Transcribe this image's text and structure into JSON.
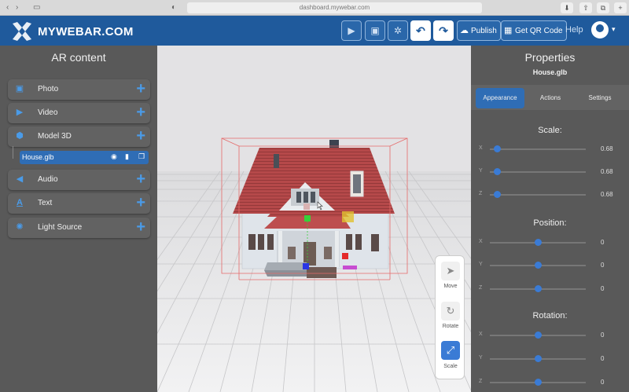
{
  "browser": {
    "url": "dashboard.mywebar.com",
    "nav_back": "‹",
    "nav_forward": "›",
    "sidebar_toggle": "▭",
    "shield": "◐",
    "download": "⬇",
    "share": "⇧",
    "tabs": "⧉",
    "add_tab": "+"
  },
  "header": {
    "brand": "MYWEBAR.COM",
    "publish": "Publish",
    "qr": "Get QR Code",
    "help": "Help",
    "icons": {
      "play": "▶",
      "save": "▣",
      "settings": "✲",
      "undo": "↶",
      "redo": "↷",
      "cloud": "☁",
      "qr": "▦",
      "caret": "▾"
    }
  },
  "left_panel": {
    "title": "AR content",
    "items": [
      {
        "label": "Photo",
        "icon": "photo-icon",
        "glyph": "▣"
      },
      {
        "label": "Video",
        "icon": "video-icon",
        "glyph": "▶"
      },
      {
        "label": "Model 3D",
        "icon": "cube-icon",
        "glyph": "⬢"
      },
      {
        "label": "Audio",
        "icon": "speaker-icon",
        "glyph": "◀"
      },
      {
        "label": "Text",
        "icon": "text-icon",
        "glyph": "A"
      },
      {
        "label": "Light Source",
        "icon": "light-icon",
        "glyph": "✺"
      }
    ],
    "plus": "+",
    "selected_file": "House.glb",
    "file_icons": {
      "eye": "◉",
      "trash": "▮",
      "copy": "❐"
    }
  },
  "tools": {
    "move": "Move",
    "rotate": "Rotate",
    "scale": "Scale",
    "move_glyph": "➤",
    "rotate_glyph": "↻",
    "scale_glyph": "⤢"
  },
  "right_panel": {
    "title": "Properties",
    "file_name": "House.glb",
    "tabs": [
      "Appearance",
      "Actions",
      "Settings"
    ],
    "sections": [
      {
        "title": "Scale:",
        "rows": [
          {
            "axis": "X",
            "value": "0.68",
            "level": 0.08
          },
          {
            "axis": "Y",
            "value": "0.68",
            "level": 0.08
          },
          {
            "axis": "Z",
            "value": "0.68",
            "level": 0.08
          }
        ]
      },
      {
        "title": "Position:",
        "rows": [
          {
            "axis": "X",
            "value": "0",
            "level": 0.5
          },
          {
            "axis": "Y",
            "value": "0",
            "level": 0.5
          },
          {
            "axis": "Z",
            "value": "0",
            "level": 0.5
          }
        ]
      },
      {
        "title": "Rotation:",
        "rows": [
          {
            "axis": "X",
            "value": "0",
            "level": 0.5
          },
          {
            "axis": "Y",
            "value": "0",
            "level": 0.5
          },
          {
            "axis": "Z",
            "value": "0",
            "level": 0.5
          }
        ]
      }
    ]
  },
  "colors": {
    "brand_blue": "#1f5a9c",
    "accent": "#3a7bd5",
    "panel": "#595959"
  }
}
